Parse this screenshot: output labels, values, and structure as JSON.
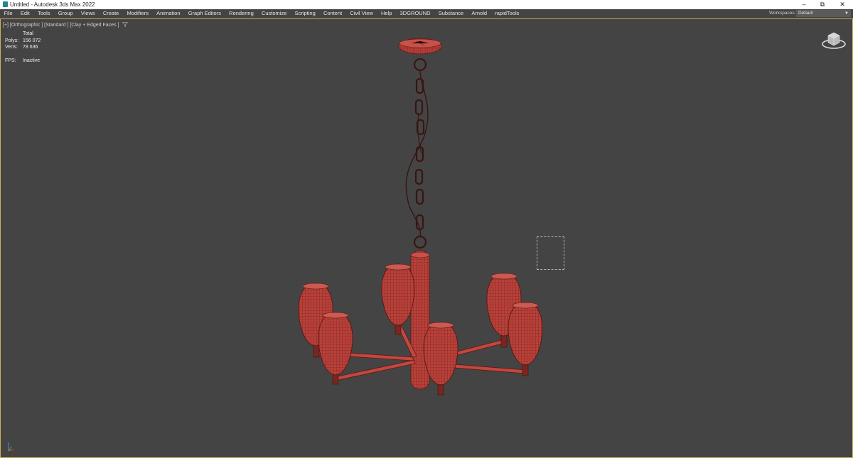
{
  "window": {
    "title": "Untitled - Autodesk 3ds Max 2022",
    "controls": {
      "minimize": "–",
      "restore": "⧉",
      "close": "✕"
    }
  },
  "menubar": {
    "items": [
      "File",
      "Edit",
      "Tools",
      "Group",
      "Views",
      "Create",
      "Modifiers",
      "Animation",
      "Graph Editors",
      "Rendering",
      "Customize",
      "Scripting",
      "Content",
      "Civil View",
      "Help",
      "3DGROUND",
      "Substance",
      "Arnold",
      "rapidTools"
    ],
    "workspace_label": "Workspaces:",
    "workspace_value": "Default"
  },
  "viewport": {
    "label": "[+] [Orthographic ] [Standard ] [Clay + Edged Faces ]",
    "filter_icon": "funnel-icon",
    "stats": {
      "total_label": "Total",
      "polys_label": "Polys:",
      "polys_value": "156 072",
      "verts_label": "Verts:",
      "verts_value": "78 636",
      "fps_label": "FPS:",
      "fps_value": "Inactive"
    }
  },
  "colors": {
    "viewport_bg": "#444444",
    "model_clay": "#b8413a",
    "viewport_border": "#c9b15a"
  }
}
